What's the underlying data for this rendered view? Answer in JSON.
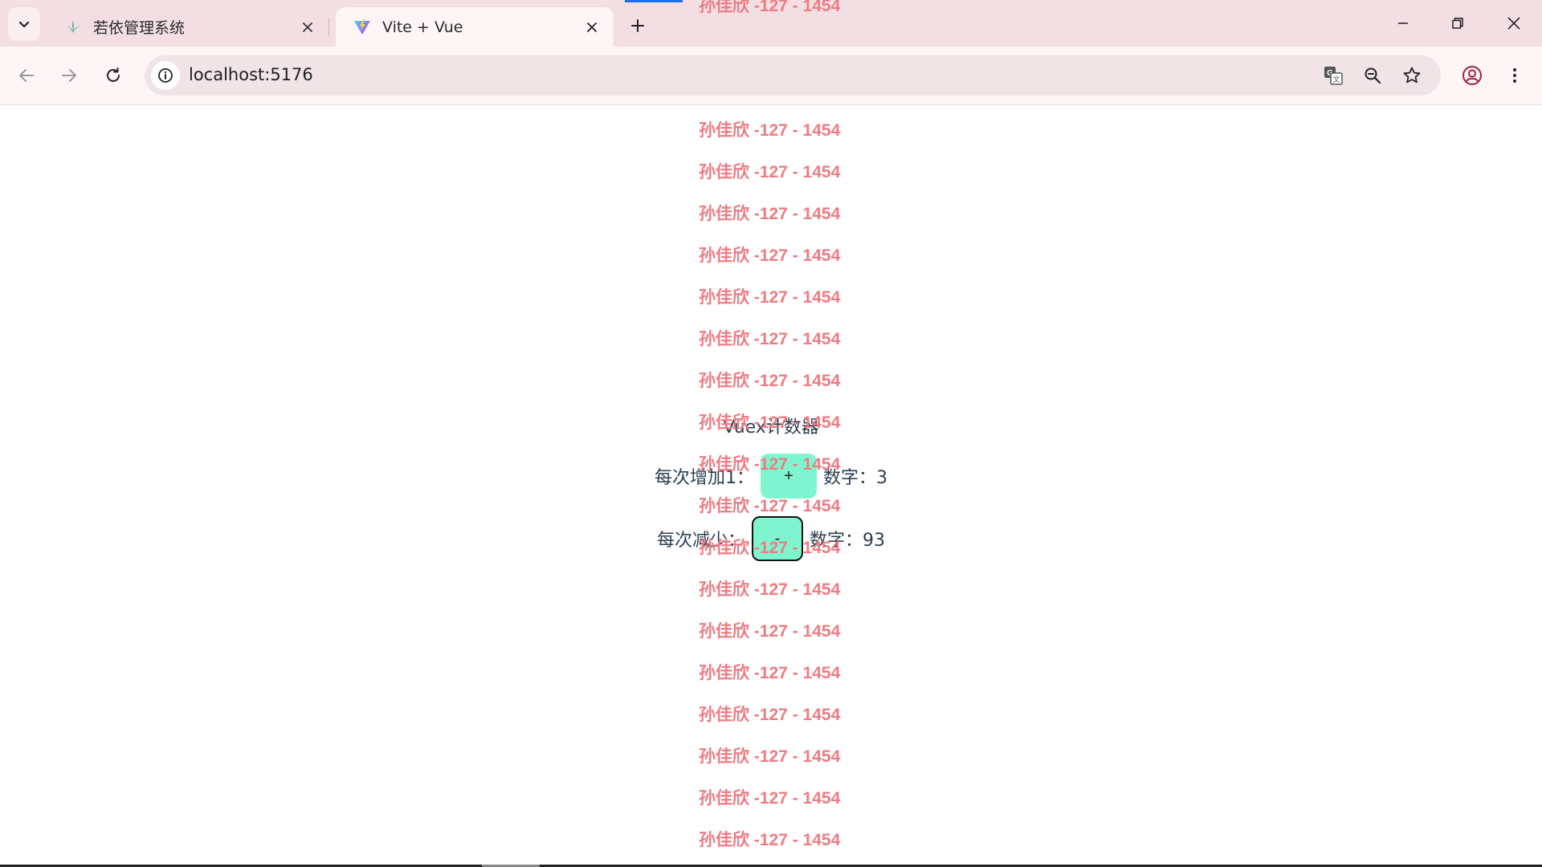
{
  "browser": {
    "tabs": [
      {
        "title": "若依管理系统",
        "active": false
      },
      {
        "title": "Vite + Vue",
        "active": true
      }
    ],
    "url": "localhost:5176",
    "accent_color": "#1a73e8"
  },
  "page": {
    "watermark_text": "孙佳欣 -127 - 1454",
    "watermark_color": "#ef7b82",
    "title": "Vuex计数器",
    "increment": {
      "label": "每次增加1：",
      "button_label": "+",
      "value_label": "数字：3"
    },
    "decrement": {
      "label": "每次减少：",
      "button_label": "-",
      "value_label": "数字：93"
    },
    "button_color": "#7ff5cf"
  }
}
